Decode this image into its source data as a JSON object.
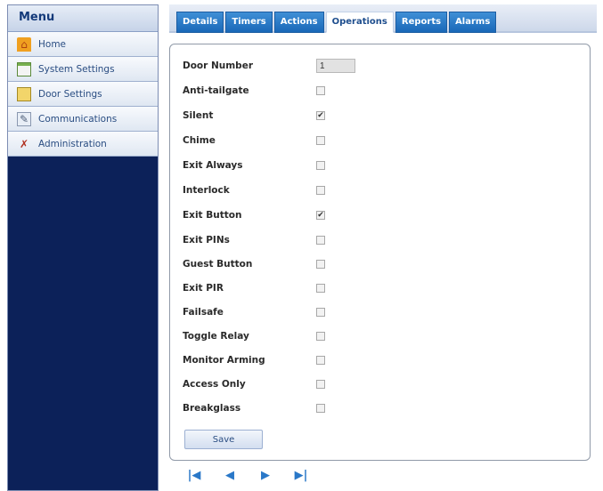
{
  "sidebar": {
    "title": "Menu",
    "items": [
      {
        "label": "Home",
        "icon": "home-icon"
      },
      {
        "label": "System Settings",
        "icon": "system-settings-icon"
      },
      {
        "label": "Door Settings",
        "icon": "door-icon"
      },
      {
        "label": "Communications",
        "icon": "communications-icon"
      },
      {
        "label": "Administration",
        "icon": "administration-icon"
      }
    ]
  },
  "tabs": [
    {
      "label": "Details",
      "active": false
    },
    {
      "label": "Timers",
      "active": false
    },
    {
      "label": "Actions",
      "active": false
    },
    {
      "label": "Operations",
      "active": true
    },
    {
      "label": "Reports",
      "active": false
    },
    {
      "label": "Alarms",
      "active": false
    }
  ],
  "form": {
    "door_number": {
      "label": "Door Number",
      "value": "1"
    },
    "options": [
      {
        "label": "Anti-tailgate",
        "checked": false
      },
      {
        "label": "Silent",
        "checked": true
      },
      {
        "label": "Chime",
        "checked": false
      },
      {
        "label": "Exit Always",
        "checked": false
      },
      {
        "label": "Interlock",
        "checked": false
      },
      {
        "label": "Exit Button",
        "checked": true
      },
      {
        "label": "Exit PINs",
        "checked": false
      },
      {
        "label": "Guest Button",
        "checked": false
      },
      {
        "label": "Exit PIR",
        "checked": false
      },
      {
        "label": "Failsafe",
        "checked": false
      },
      {
        "label": "Toggle Relay",
        "checked": false
      },
      {
        "label": "Monitor Arming",
        "checked": false
      },
      {
        "label": "Access Only",
        "checked": false
      },
      {
        "label": "Breakglass",
        "checked": false
      }
    ],
    "save_label": "Save"
  },
  "pager": {
    "first": "|◀",
    "prev": "◀",
    "next": "▶",
    "last": "▶|"
  },
  "colors": {
    "sidebar_bg": "#0c2159",
    "tab_blue": "#2a7ccb",
    "link_blue": "#2a78c8"
  }
}
